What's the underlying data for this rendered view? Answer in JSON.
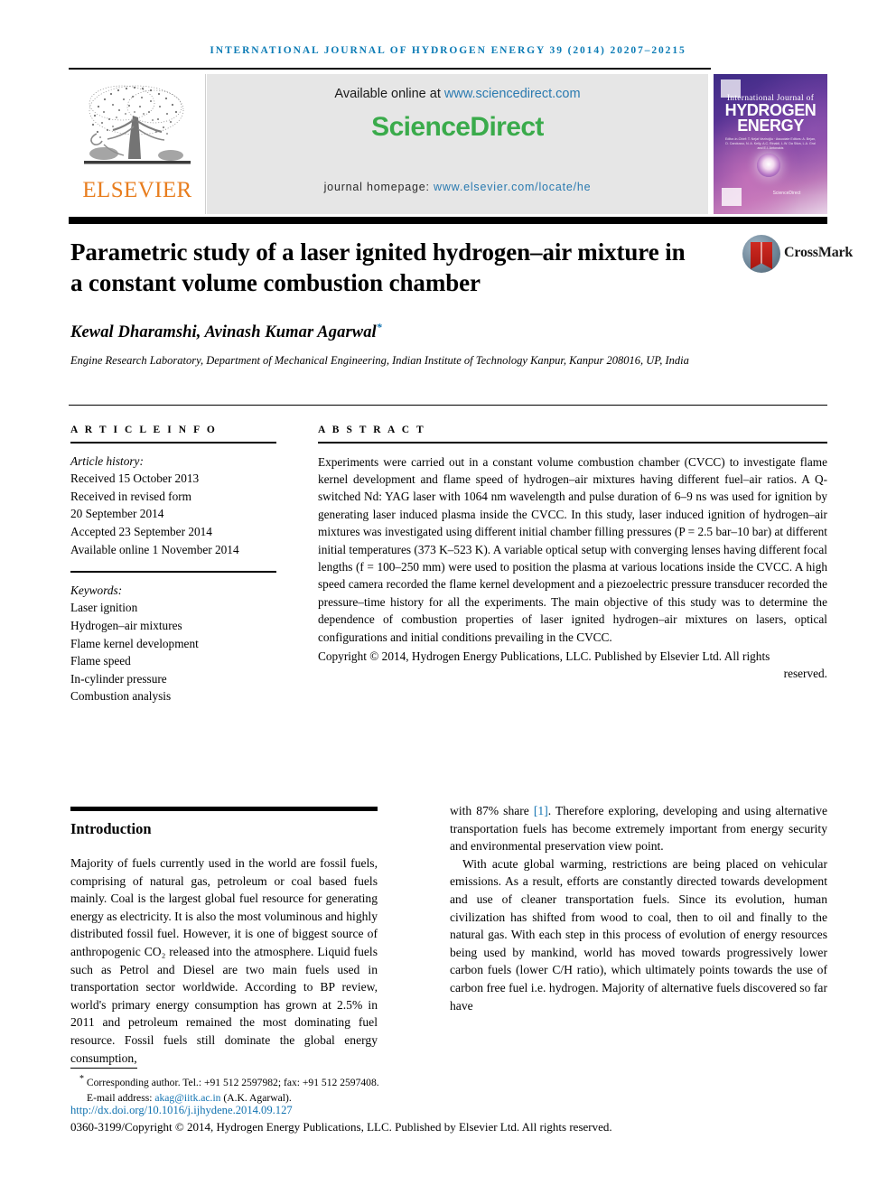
{
  "running_head": "International Journal of Hydrogen Energy 39 (2014) 20207–20215",
  "masthead": {
    "publisher_name": "ELSEVIER",
    "available_prefix": "Available online at ",
    "available_url": "www.sciencedirect.com",
    "sciencedirect_logo": "ScienceDirect",
    "homepage_prefix": "journal homepage: ",
    "homepage_url": "www.elsevier.com/locate/he",
    "cover": {
      "line1": "International Journal of",
      "line2": "HYDROGEN",
      "line3": "ENERGY",
      "editors": "Editor-in-Chief: T. Nejat Veziroğlu · Associate Editors: A. Bejan, D. Candusso, N. A. Kelly, A.C. Rinaldi, L.W. Da Silva, L.A. Gral and E.I. Antonakis",
      "science_direct": "ScienceDirect"
    }
  },
  "article": {
    "title": "Parametric study of a laser ignited hydrogen–air mixture in a constant volume combustion chamber",
    "crossmark_label": "CrossMark",
    "authors": "Kewal Dharamshi, Avinash Kumar Agarwal",
    "author_marker": "*",
    "affiliation": "Engine Research Laboratory, Department of Mechanical Engineering, Indian Institute of Technology Kanpur, Kanpur 208016, UP, India"
  },
  "article_info": {
    "heading": "A R T I C L E   I N F O",
    "history_label": "Article history:",
    "history": [
      "Received 15 October 2013",
      "Received in revised form",
      "20 September 2014",
      "Accepted 23 September 2014",
      "Available online 1 November 2014"
    ],
    "keywords_label": "Keywords:",
    "keywords": [
      "Laser ignition",
      "Hydrogen–air mixtures",
      "Flame kernel development",
      "Flame speed",
      "In-cylinder pressure",
      "Combustion analysis"
    ]
  },
  "abstract": {
    "heading": "A B S T R A C T",
    "body": "Experiments were carried out in a constant volume combustion chamber (CVCC) to investigate flame kernel development and flame speed of hydrogen–air mixtures having different fuel–air ratios. A Q-switched Nd: YAG laser with 1064 nm wavelength and pulse duration of 6–9 ns was used for ignition by generating laser induced plasma inside the CVCC. In this study, laser induced ignition of hydrogen–air mixtures was investigated using different initial chamber filling pressures (P = 2.5 bar–10 bar) at different initial temperatures (373 K–523 K). A variable optical setup with converging lenses having different focal lengths (f = 100–250 mm) were used to position the plasma at various locations inside the CVCC. A high speed camera recorded the flame kernel development and a piezoelectric pressure transducer recorded the pressure–time history for all the experiments. The main objective of this study was to determine the dependence of combustion properties of laser ignited hydrogen–air mixtures on lasers, optical configurations and initial conditions prevailing in the CVCC.",
    "copyright": "Copyright © 2014, Hydrogen Energy Publications, LLC. Published by Elsevier Ltd. All rights",
    "copyright_last": "reserved."
  },
  "body": {
    "section_heading": "Introduction",
    "left_paragraphs": [
      "Majority of fuels currently used in the world are fossil fuels, comprising of natural gas, petroleum or coal based fuels mainly. Coal is the largest global fuel resource for generating energy as electricity. It is also the most voluminous and highly distributed fossil fuel. However, it is one of biggest source of anthropogenic CO₂ released into the atmosphere. Liquid fuels such as Petrol and Diesel are two main fuels used in transportation sector worldwide. According to BP review, world's primary energy consumption has grown at 2.5% in 2011 and petroleum remained the most dominating fuel resource. Fossil fuels still dominate the global energy consumption,"
    ],
    "right_paragraph_1_pre": "with 87% share ",
    "right_paragraph_1_ref": "[1]",
    "right_paragraph_1_post": ". Therefore exploring, developing and using alternative transportation fuels has become extremely important from energy security and environmental preservation view point.",
    "right_paragraph_2": "With acute global warming, restrictions are being placed on vehicular emissions. As a result, efforts are constantly directed towards development and use of cleaner transportation fuels. Since its evolution, human civilization has shifted from wood to coal, then to oil and finally to the natural gas. With each step in this process of evolution of energy resources being used by mankind, world has moved towards progressively lower carbon fuels (lower C/H ratio), which ultimately points towards the use of carbon free fuel i.e. hydrogen. Majority of alternative fuels discovered so far have"
  },
  "footer": {
    "corresponding": "Corresponding author. Tel.: +91 512 2597982; fax: +91 512 2597408.",
    "email_label": "E-mail address: ",
    "email": "akag@iitk.ac.in",
    "email_suffix": " (A.K. Agarwal).",
    "doi": "http://dx.doi.org/10.1016/j.ijhydene.2014.09.127",
    "issn_line": "0360-3199/Copyright © 2014, Hydrogen Energy Publications, LLC. Published by Elsevier Ltd. All rights reserved."
  },
  "colors": {
    "journal_blue": "#0b7bb5",
    "link_blue": "#1072b0",
    "sciencedirect_green": "#3aab4b",
    "elsevier_orange": "#e87d1e",
    "crossmark_red": "#cf2a22"
  }
}
